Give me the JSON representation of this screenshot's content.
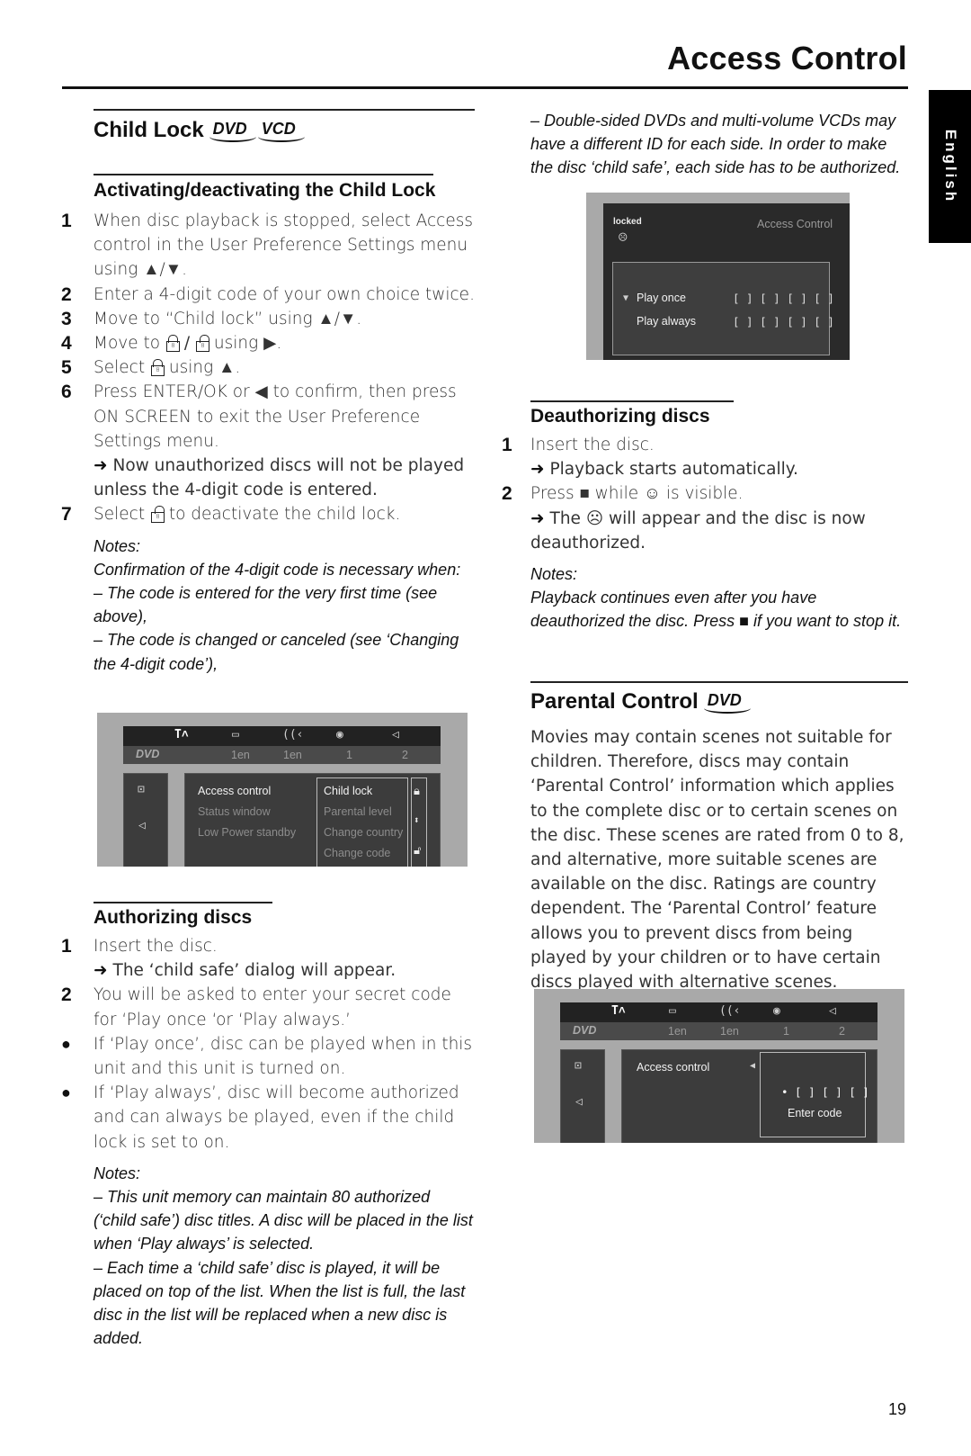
{
  "header": {
    "title": "Access Control",
    "language_tab": "English"
  },
  "left": {
    "child_lock": {
      "title": "Child Lock",
      "logos": [
        "DVD",
        "VCD"
      ],
      "subtitle": "Activating/deactivating the Child Lock",
      "steps": [
        {
          "num": "1",
          "text": "When disc playback is stopped, select Access control in the User Preference Settings menu using ▲/▼."
        },
        {
          "num": "2",
          "text": "Enter a 4-digit code of your own choice twice."
        },
        {
          "num": "3",
          "text": "Move to “Child lock” using ▲/▼."
        },
        {
          "num": "4",
          "pre": "Move to",
          "sep": "/",
          "post": "using ▶."
        },
        {
          "num": "5",
          "pre": "Select",
          "post": "using ▲."
        },
        {
          "num": "6",
          "text": "Press ENTER/OK or ◀ to confirm, then press ON SCREEN to exit the User Preference Settings menu."
        },
        {
          "num": "7",
          "pre": "Select",
          "post": "to deactivate the child lock."
        }
      ],
      "step6_result": "Now unauthorized discs will not be played unless the 4-digit code is entered.",
      "arrow": "➜",
      "notes_heading": "Notes:",
      "notes": [
        "Confirmation of the 4-digit code is necessary when:",
        "–   The code is entered for the very first time (see above),",
        "–   The code is changed or canceled (see ‘Changing the 4-digit code’),"
      ]
    },
    "screen1": {
      "logo": "DVD",
      "bar_values": [
        "1en",
        "1en",
        "1",
        "2"
      ],
      "menu_items": [
        "Access control",
        "Status window",
        "Low Power standby"
      ],
      "submenu_items": [
        "Child lock",
        "Parental level",
        "Change country",
        "Change code"
      ]
    },
    "authorizing": {
      "title": "Authorizing discs",
      "steps": [
        {
          "num": "1",
          "text": "Insert the disc."
        },
        {
          "num": "2",
          "text": "You will be asked to enter your secret code for ‘Play once ‘or ‘Play always.’"
        }
      ],
      "step1_result": "The ‘child safe’ dialog will appear.",
      "bullets": [
        "If ‘Play once’, disc can be played when in this unit and this unit is turned on.",
        "If ‘Play always’, disc will become authorized and can always be played, even if the child lock is set to on."
      ],
      "bullet_glyph": "●",
      "notes_heading": "Notes:",
      "notes": [
        "–   This unit memory can maintain 80 authorized (‘child safe’) disc titles. A disc will be placed in the list when ‘Play always’ is selected.",
        "–   Each time a ‘child safe’ disc is played, it will be placed on top of the list. When the list is full, the last disc in the list will be replaced when a new disc is added."
      ]
    }
  },
  "right": {
    "top_note": "–   Double-sided DVDs and multi-volume VCDs may have a different ID for each side. In order to make the disc ‘child safe’, each side has to be authorized.",
    "screen2": {
      "status": "locked",
      "header": "Access Control",
      "options": [
        "Play once",
        "Play always"
      ],
      "code_slots": "[ ]  [ ]  [ ]  [ ]"
    },
    "deauthorizing": {
      "title": "Deauthorizing discs",
      "steps": [
        {
          "num": "1",
          "text": "Insert the disc."
        },
        {
          "num": "2",
          "pre": "Press ■ while",
          "post": "is visible."
        }
      ],
      "step1_result": "Playback starts automatically.",
      "step2_result_pre": "The",
      "step2_result_post": "will appear and the disc is now deauthorized.",
      "smile": "☺",
      "frown": "☹",
      "notes_heading": "Notes:",
      "notes": [
        "Playback continues even after you have deauthorized the disc. Press ■ if you want to stop it."
      ]
    },
    "parental": {
      "title": "Parental Control",
      "logo": "DVD",
      "body": "Movies may contain scenes not suitable for children. Therefore, discs may contain ‘Parental Control’ information which applies to the complete disc or to certain scenes on the disc. These scenes are rated from 0 to 8, and alternative, more suitable scenes are available on the disc. Ratings are country dependent. The ‘Parental Control’ feature allows you to prevent discs from being played by your children or to have certain discs played with alternative scenes."
    },
    "screen3": {
      "logo": "DVD",
      "bar_values": [
        "1en",
        "1en",
        "1",
        "2"
      ],
      "menu_item": "Access control",
      "code_entry": "•  [ ] [ ] [ ]",
      "code_label": "Enter code"
    }
  },
  "footer": {
    "page_number": "19"
  }
}
